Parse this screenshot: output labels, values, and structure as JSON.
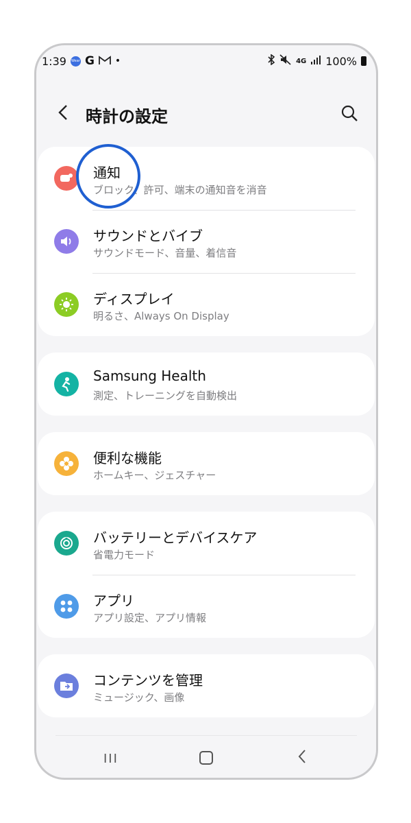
{
  "status_bar": {
    "time": "1:39",
    "wear_icon_label": "Wear",
    "icons": [
      "wear-icon",
      "google-icon",
      "gmail-icon",
      "notification-dot",
      "bluetooth-icon",
      "mute-icon",
      "signal-4g-icon",
      "signal-bars-icon",
      "battery-icon"
    ],
    "network": "4G",
    "battery": "100%"
  },
  "header": {
    "title": "時計の設定"
  },
  "groups": [
    {
      "items": [
        {
          "title": "通知",
          "subtitle": "ブロック、許可、端末の通知音を消音",
          "icon": "notification-icon",
          "color": "#f2685f"
        },
        {
          "title": "サウンドとバイブ",
          "subtitle": "サウンドモード、音量、着信音",
          "icon": "sound-icon",
          "color": "#8f7ce8"
        },
        {
          "title": "ディスプレイ",
          "subtitle": "明るさ、Always On Display",
          "icon": "display-icon",
          "color": "#8ccc24"
        }
      ]
    },
    {
      "items": [
        {
          "title": "Samsung Health",
          "subtitle": "測定、トレーニングを自動検出",
          "icon": "health-icon",
          "color": "#14b3a4"
        }
      ]
    },
    {
      "items": [
        {
          "title": "便利な機能",
          "subtitle": "ホームキー、ジェスチャー",
          "icon": "advanced-features-icon",
          "color": "#f6b23a"
        }
      ]
    },
    {
      "items": [
        {
          "title": "バッテリーとデバイスケア",
          "subtitle": "省電力モード",
          "icon": "battery-care-icon",
          "color": "#1aa88e"
        },
        {
          "title": "アプリ",
          "subtitle": "アプリ設定、アプリ情報",
          "icon": "apps-icon",
          "color": "#4f9be8"
        }
      ]
    },
    {
      "items": [
        {
          "title": "コンテンツを管理",
          "subtitle": "ミュージック、画像",
          "icon": "content-icon",
          "color": "#6b7fdd"
        }
      ]
    }
  ],
  "nav_bar": {
    "recent_label": "III"
  },
  "annotation": {
    "highlight_target": "通知",
    "color": "#1f5fd1"
  }
}
